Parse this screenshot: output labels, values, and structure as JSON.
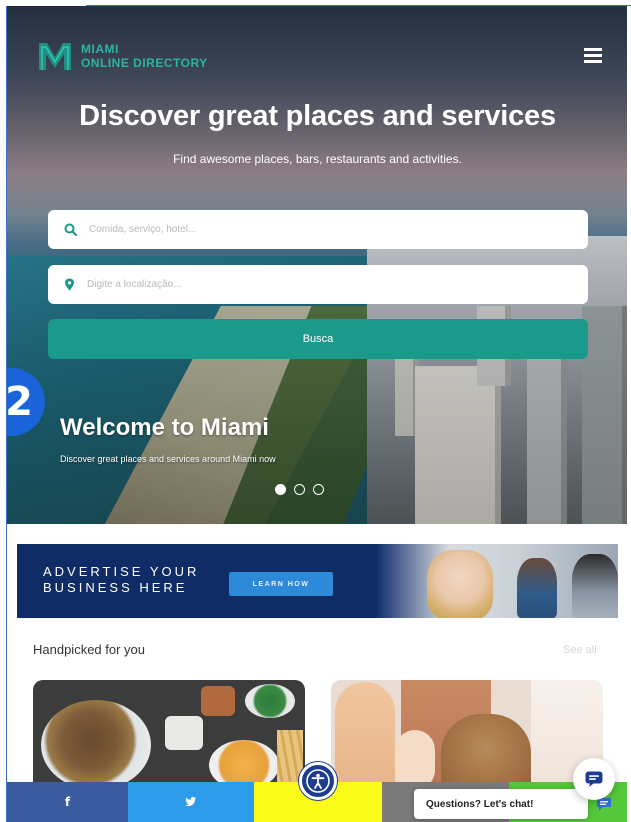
{
  "brand": {
    "line1": "MIAMI",
    "line2": "ONLINE DIRECTORY",
    "accent_color": "#2bb3a3"
  },
  "header": {
    "menu_icon": "hamburger-menu-icon"
  },
  "hero": {
    "title": "Discover great places and services",
    "subtitle": "Find awesome places, bars, restaurants and activities.",
    "search": {
      "what_placeholder": "Comida, serviço, hotel...",
      "where_placeholder": "Digite a localização...",
      "button_label": "Busca",
      "button_color": "#1b9a8c"
    },
    "slide": {
      "title": "Welcome to Miami",
      "subtitle": "Discover great places and services around Miami now"
    },
    "carousel": {
      "total": 3,
      "active": 1
    }
  },
  "step_badge": "2",
  "ad": {
    "line1": "ADVERTISE YOUR",
    "line2": "BUSINESS HERE",
    "cta": "LEARN HOW"
  },
  "handpicked": {
    "title": "Handpicked for you",
    "see_all": "See all"
  },
  "share_bar": {
    "facebook": "f",
    "twitter": "🐦",
    "colors": {
      "facebook": "#3a5ba0",
      "twitter": "#2c9be8",
      "snapchat": "#fbfb19",
      "other": "#7a7a7a",
      "whatsapp": "#54c83a"
    }
  },
  "chat": {
    "prompt": "Questions? Let's chat!"
  }
}
